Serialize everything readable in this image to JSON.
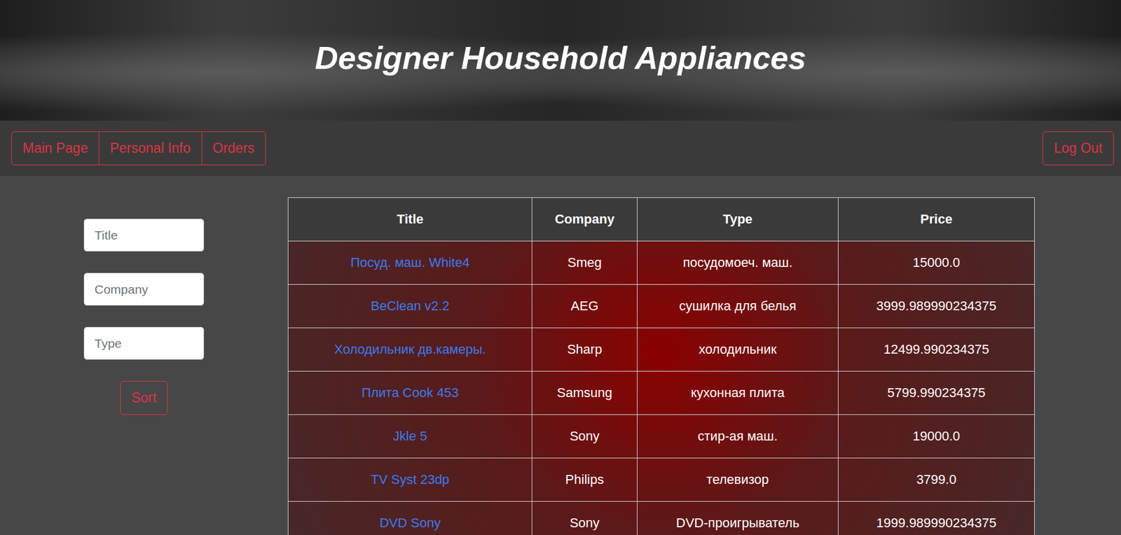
{
  "header": {
    "title": "Designer Household Appliances"
  },
  "nav": {
    "items": [
      "Main Page",
      "Personal Info",
      "Orders"
    ],
    "logout": "Log Out"
  },
  "filters": {
    "placeholders": [
      "Title",
      "Company",
      "Type"
    ],
    "button": "Sort"
  },
  "table": {
    "columns": [
      "Title",
      "Company",
      "Type",
      "Price"
    ],
    "rows": [
      [
        "Посуд. маш. White4",
        "Smeg",
        "посудомоеч. маш.",
        "15000.0"
      ],
      [
        "BeClean v2.2",
        "AEG",
        "сушилка для белья",
        "3999.989990234375"
      ],
      [
        "Холодильник дв.камеры.",
        "Sharp",
        "холодильник",
        "12499.990234375"
      ],
      [
        "Плита Cook 453",
        "Samsung",
        "кухонная плита",
        "5799.990234375"
      ],
      [
        "Jkle 5",
        "Sony",
        "стир-ая маш.",
        "19000.0"
      ],
      [
        "TV Syst 23dp",
        "Philips",
        "телевизор",
        "3799.0"
      ],
      [
        "DVD Sony",
        "Sony",
        "DVD-проигрыватель",
        "1999.989990234375"
      ]
    ]
  }
}
